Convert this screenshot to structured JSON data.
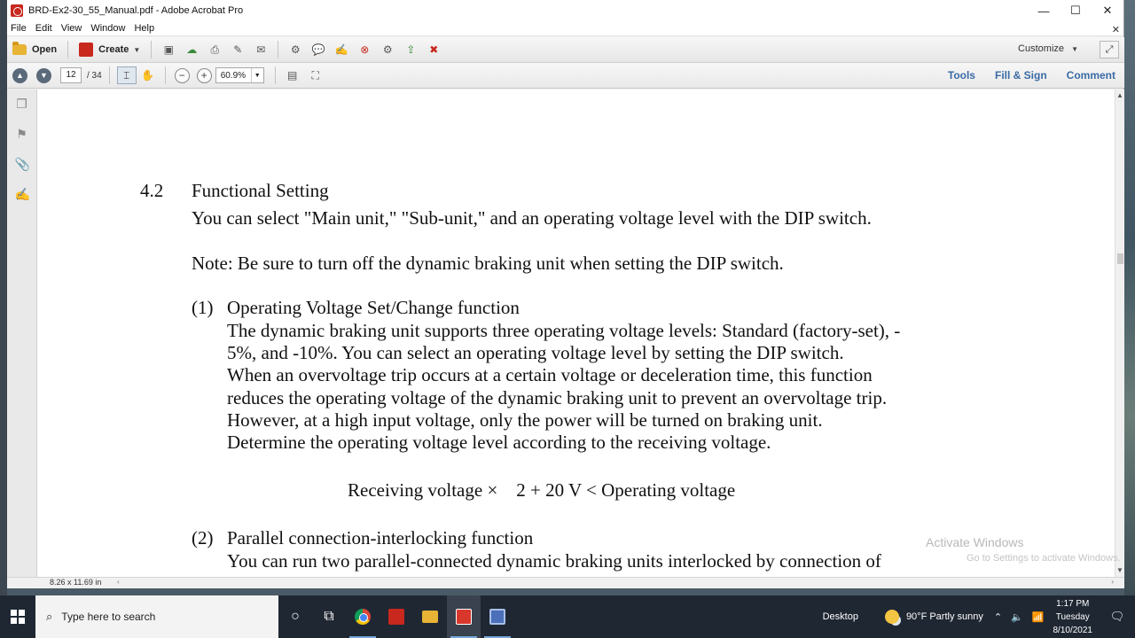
{
  "window": {
    "title": "BRD-Ex2-30_55_Manual.pdf - Adobe Acrobat Pro",
    "minimize": "—",
    "maximize": "☐",
    "close": "✕"
  },
  "menu": [
    "File",
    "Edit",
    "View",
    "Window",
    "Help"
  ],
  "menu_close": "✕",
  "toolbar": {
    "open_label": "Open",
    "create_label": "Create",
    "customize_label": "Customize",
    "icons": [
      "save-icon",
      "upload-icon",
      "print-icon",
      "edit-icon",
      "email-icon",
      "gear-icon",
      "comment-icon",
      "sign-icon",
      "stamp-icon",
      "settings-icon",
      "export-icon",
      "delete-icon"
    ]
  },
  "navigation": {
    "page_current": "12",
    "page_total": "/ 34",
    "zoom_level": "60.9%"
  },
  "panels": {
    "tools": "Tools",
    "fill_sign": "Fill & Sign",
    "comment": "Comment"
  },
  "document": {
    "section_number": "4.2",
    "section_title": "Functional Setting",
    "intro": "You can select \"Main unit,\" \"Sub-unit,\" and an operating voltage level with the DIP switch.",
    "note": "Note: Be sure to turn off the dynamic braking unit when setting the DIP switch.",
    "item1_num": "(1)",
    "item1_title": "Operating Voltage Set/Change function",
    "item1_lines": [
      "The dynamic braking unit supports three operating voltage levels: Standard (factory-set), -",
      "5%, and -10%.    You can select an operating voltage level by setting the DIP switch.",
      "When an overvoltage trip occurs at a certain voltage or deceleration time, this function",
      "reduces the operating voltage of the dynamic braking unit to prevent an overvoltage trip.",
      "However, at a high input voltage, only the power will be turned on braking unit.",
      "Determine the operating voltage level according to the receiving voltage."
    ],
    "formula": "Receiving voltage ×    2 + 20 V < Operating voltage",
    "item2_num": "(2)",
    "item2_title": "Parallel connection-interlocking function",
    "item2_line": "You can run two parallel-connected dynamic braking units interlocked by connection of"
  },
  "statusbar": {
    "page_size": "8.26 x 11.69 in"
  },
  "watermark": {
    "line1": "Activate Windows",
    "line2": "Go to Settings to activate Windows."
  },
  "taskbar": {
    "search_placeholder": "Type here to search",
    "desktop_label": "Desktop",
    "weather": "90°F  Partly sunny",
    "time": "1:17 PM",
    "day": "Tuesday",
    "date": "8/10/2021"
  }
}
